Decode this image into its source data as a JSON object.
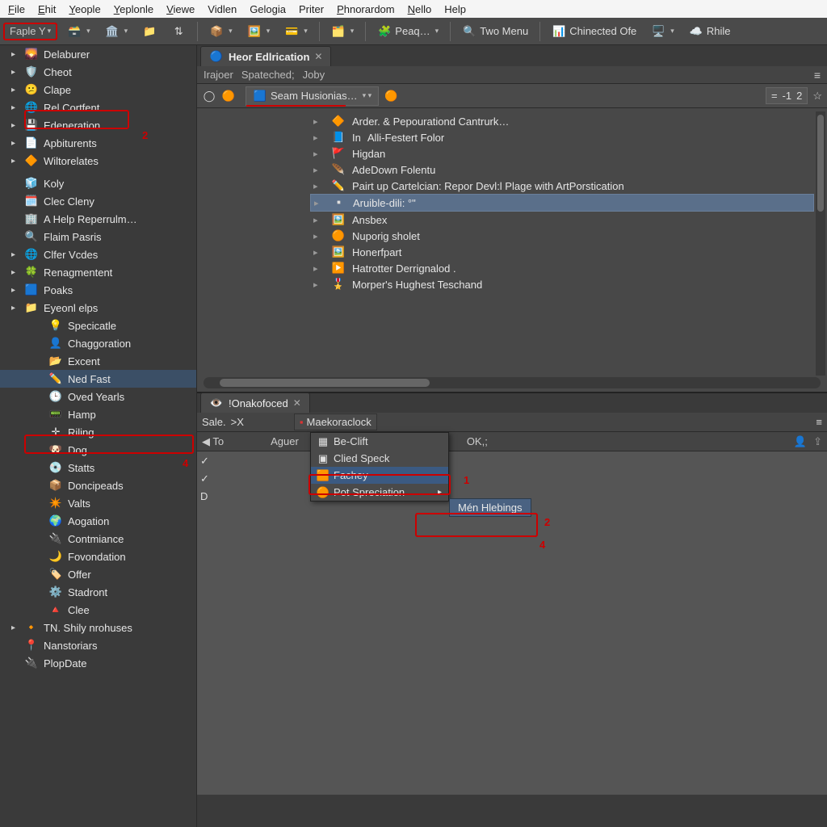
{
  "menubar": [
    "File",
    "Ehit",
    "Yeople",
    "Yeplonle",
    "Viewe",
    "Vidlen",
    "Gelogia",
    "Priter",
    "Phnorardom",
    "Nello",
    "Help"
  ],
  "toolbar": {
    "fable": "Faple Y",
    "peaq": "Peaq…",
    "two_menu": "Two Menu",
    "chinected": "Chinected Ofe",
    "rhile": "Rhile"
  },
  "sidebar": {
    "groups": [
      {
        "label": "Delaburer",
        "exp": true,
        "icon": "cloud"
      },
      {
        "label": "Cheot",
        "exp": true,
        "icon": "shield"
      },
      {
        "label": "Clape",
        "exp": true,
        "icon": "face"
      },
      {
        "label": "Rel Cortfent",
        "exp": true,
        "icon": "globe"
      },
      {
        "label": "Edeneration",
        "exp": true,
        "icon": "drive",
        "annot": "2"
      },
      {
        "label": "Apbiturents",
        "exp": true,
        "icon": "doc"
      },
      {
        "label": "Wiltorelates",
        "exp": true,
        "icon": "diamond-orange"
      }
    ],
    "mid": [
      {
        "label": "Koly",
        "icon": "cube"
      },
      {
        "label": "Clec Cleny",
        "icon": "grid"
      },
      {
        "label": "A Help Reperrulm…",
        "icon": "building"
      },
      {
        "label": "Flaim Pasris",
        "icon": "search"
      },
      {
        "label": "Clfer Vcdes",
        "exp": true,
        "icon": "globe"
      },
      {
        "label": "Renagmentent",
        "exp": true,
        "icon": "leaf"
      },
      {
        "label": "Poaks",
        "exp": true,
        "icon": "app"
      },
      {
        "label": "Eyeonl elps",
        "exp": true,
        "icon": "folder",
        "children": [
          {
            "label": "Specicatle",
            "icon": "bulb"
          },
          {
            "label": "Chaggoration",
            "icon": "person"
          },
          {
            "label": "Excent",
            "icon": "folder2"
          },
          {
            "label": "Ned Fast",
            "icon": "wand",
            "selected": true
          },
          {
            "label": "Oved Yearls",
            "icon": "clock"
          },
          {
            "label": "Hamp",
            "icon": "gauge"
          },
          {
            "label": "Riling",
            "icon": "axes"
          },
          {
            "label": "Dog",
            "icon": "head"
          },
          {
            "label": "Statts",
            "icon": "disc"
          },
          {
            "label": "Doncipeads",
            "icon": "box"
          },
          {
            "label": "Valts",
            "icon": "spark"
          },
          {
            "label": "Aogation",
            "icon": "globe2"
          },
          {
            "label": "Contmiance",
            "icon": "plug"
          },
          {
            "label": "Fovondation",
            "icon": "moon"
          },
          {
            "label": "Offer",
            "icon": "tag"
          },
          {
            "label": "Stadront",
            "icon": "gear"
          },
          {
            "label": "Clee",
            "icon": "pyramid"
          }
        ]
      },
      {
        "label": "TN. Shily nrohuses",
        "exp": true,
        "icon": "diamond-orange2"
      },
      {
        "label": "Nanstoriars",
        "icon": "pin"
      },
      {
        "label": "PlopDate",
        "icon": "plug2"
      }
    ],
    "annot4": "4"
  },
  "editor": {
    "tab": "Heor Edlrication",
    "subbar": [
      "Irajoer",
      "Spateched;",
      "Joby"
    ],
    "search_label": "Seam Husionias…",
    "num_left": "-1",
    "num_right": "2",
    "items": [
      {
        "label": "Arder. & Pepourationd Cantrurk…",
        "icon": "diamond-y"
      },
      {
        "label": "Alli-Festert Folor",
        "icon": "in",
        "pre": "In"
      },
      {
        "label": "Higdan",
        "icon": "flag"
      },
      {
        "label": "AdeDown Folentu",
        "icon": "feather"
      },
      {
        "label": "Pairt up Cartelcian: Repor Devl:l Plage with ArtPorstication",
        "icon": "pencil"
      },
      {
        "label": "Aruible-dili: °\"",
        "icon": "blank",
        "selected": true
      },
      {
        "label": "Ansbex",
        "icon": "panel"
      },
      {
        "label": "Nuporig sholet",
        "icon": "orb"
      },
      {
        "label": "Honerfpart",
        "icon": "photo"
      },
      {
        "label": "Hatrotter Derrignalod .",
        "icon": "play"
      },
      {
        "label": "Morper's Hughest Teschand",
        "icon": "badge"
      }
    ]
  },
  "bottom": {
    "tab": "!Onakofoced",
    "crumbs": {
      "sale": "Sale.",
      "x": ">X",
      "maek": "Maekoraclock"
    },
    "row2": {
      "to": "◀ To",
      "aguer": "Aguer",
      "ok": "OK,;"
    },
    "checks": [
      "✓",
      "✓",
      "D"
    ],
    "menu": [
      "Be-Clift",
      "Clied Speck",
      "Fachey",
      "Pot Spreciation"
    ],
    "submenu": "Mén Hlebings",
    "annot1": "1",
    "annot2": "2",
    "annot4": "4"
  }
}
